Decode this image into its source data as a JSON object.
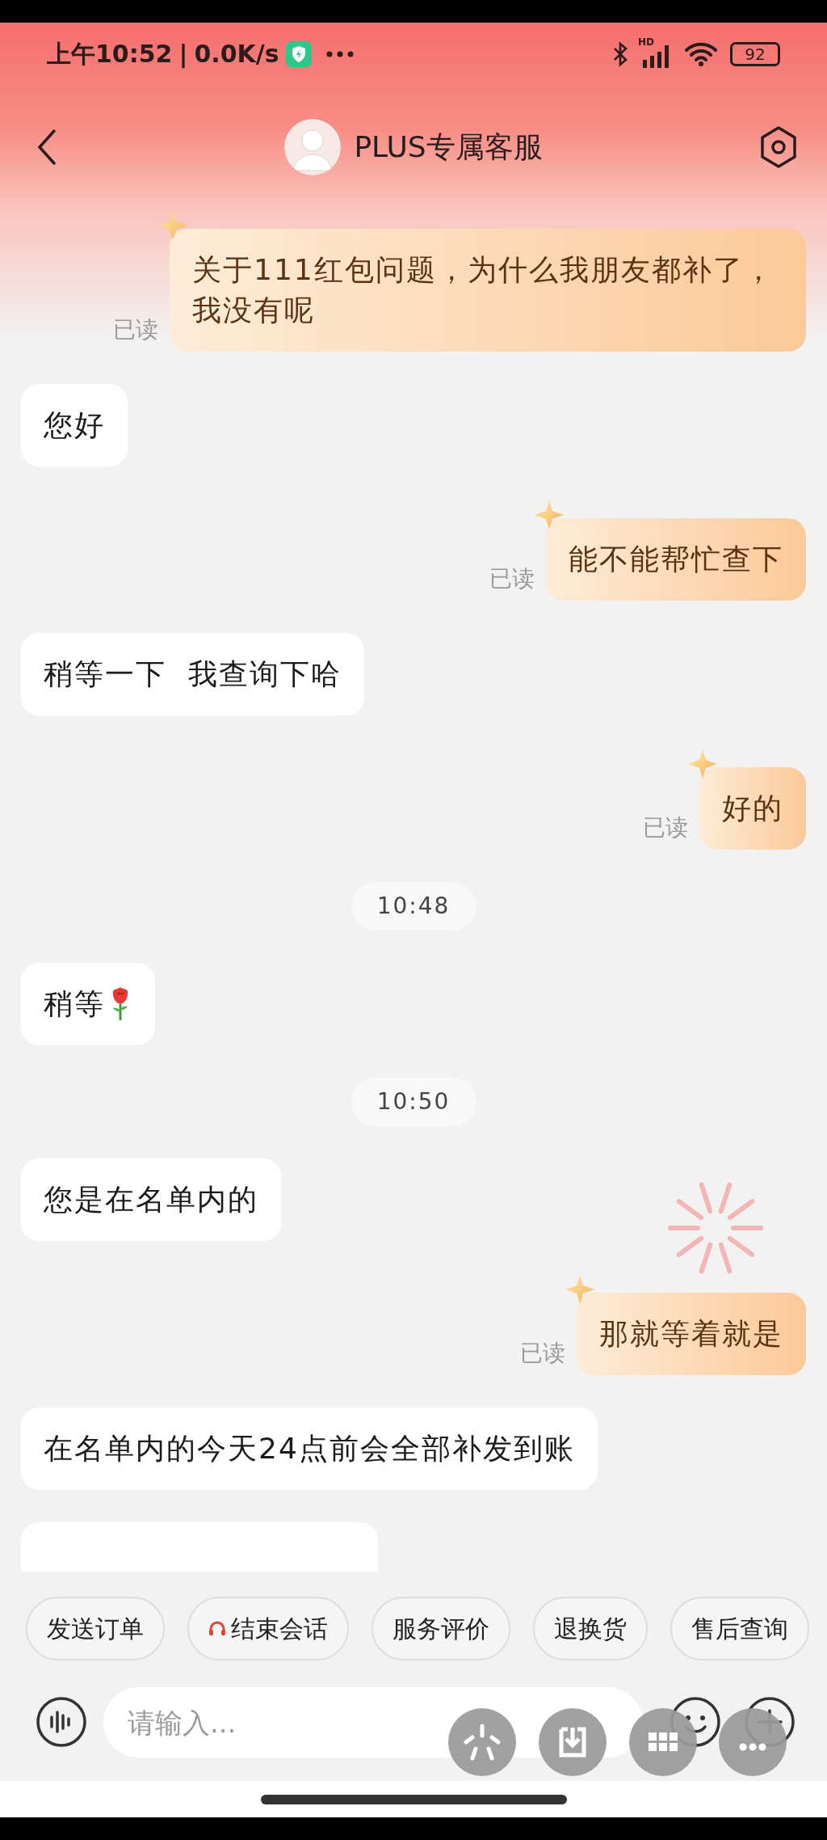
{
  "status_bar": {
    "time": "上午10:52",
    "separator": "|",
    "network_speed": "0.0K/s",
    "signal_label": "HD",
    "battery": "92"
  },
  "header": {
    "title": "PLUS专属客服"
  },
  "messages": [
    {
      "kind": "outgoing",
      "text": "关于111红包问题，为什么我朋友都补了，我没有呢",
      "read_label": "已读"
    },
    {
      "kind": "incoming",
      "text": "您好"
    },
    {
      "kind": "outgoing",
      "text": "能不能帮忙查下",
      "read_label": "已读"
    },
    {
      "kind": "incoming",
      "text": "稍等一下  我查询下哈"
    },
    {
      "kind": "outgoing",
      "text": "好的",
      "read_label": "已读"
    },
    {
      "kind": "time",
      "text": "10:48"
    },
    {
      "kind": "incoming_rose",
      "text": "稍等"
    },
    {
      "kind": "time",
      "text": "10:50"
    },
    {
      "kind": "incoming",
      "text": "您是在名单内的"
    },
    {
      "kind": "outgoing",
      "text": "那就等着就是",
      "read_label": "已读"
    },
    {
      "kind": "incoming",
      "text": "在名单内的今天24点前会全部补发到账"
    },
    {
      "kind": "clipped"
    }
  ],
  "quick_actions": [
    {
      "label": "发送订单"
    },
    {
      "label": "结束会话",
      "kind": "headset"
    },
    {
      "label": "服务评价"
    },
    {
      "label": "退换货"
    },
    {
      "label": "售后查询"
    }
  ],
  "input": {
    "placeholder": "请输入..."
  },
  "floating_buttons": [
    {
      "kind": "asterisk"
    },
    {
      "kind": "download"
    },
    {
      "kind": "grid"
    },
    {
      "kind": "more"
    }
  ]
}
